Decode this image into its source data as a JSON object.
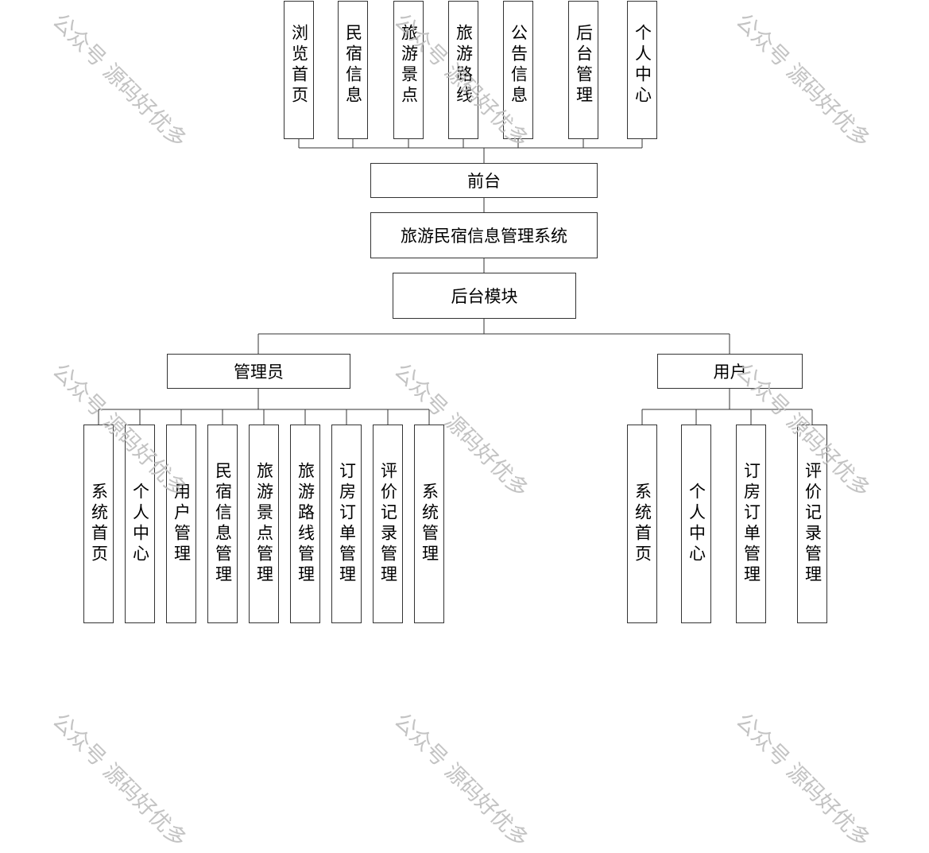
{
  "front": {
    "items": [
      "浏览首页",
      "民宿信息",
      "旅游景点",
      "旅游路线",
      "公告信息",
      "后台管理",
      "个人中心"
    ],
    "label": "前台"
  },
  "system": {
    "label": "旅游民宿信息管理系统"
  },
  "backend": {
    "label": "后台模块"
  },
  "admin": {
    "label": "管理员",
    "items": [
      "系统首页",
      "个人中心",
      "用户管理",
      "民宿信息管理",
      "旅游景点管理",
      "旅游路线管理",
      "订房订单管理",
      "评价记录管理",
      "系统管理"
    ]
  },
  "user": {
    "label": "用户",
    "items": [
      "系统首页",
      "个人中心",
      "订房订单管理",
      "评价记录管理"
    ]
  },
  "watermark": "公众号 源码好优多",
  "colors": {
    "line": "#333333",
    "watermark": "#bdbdbd"
  }
}
